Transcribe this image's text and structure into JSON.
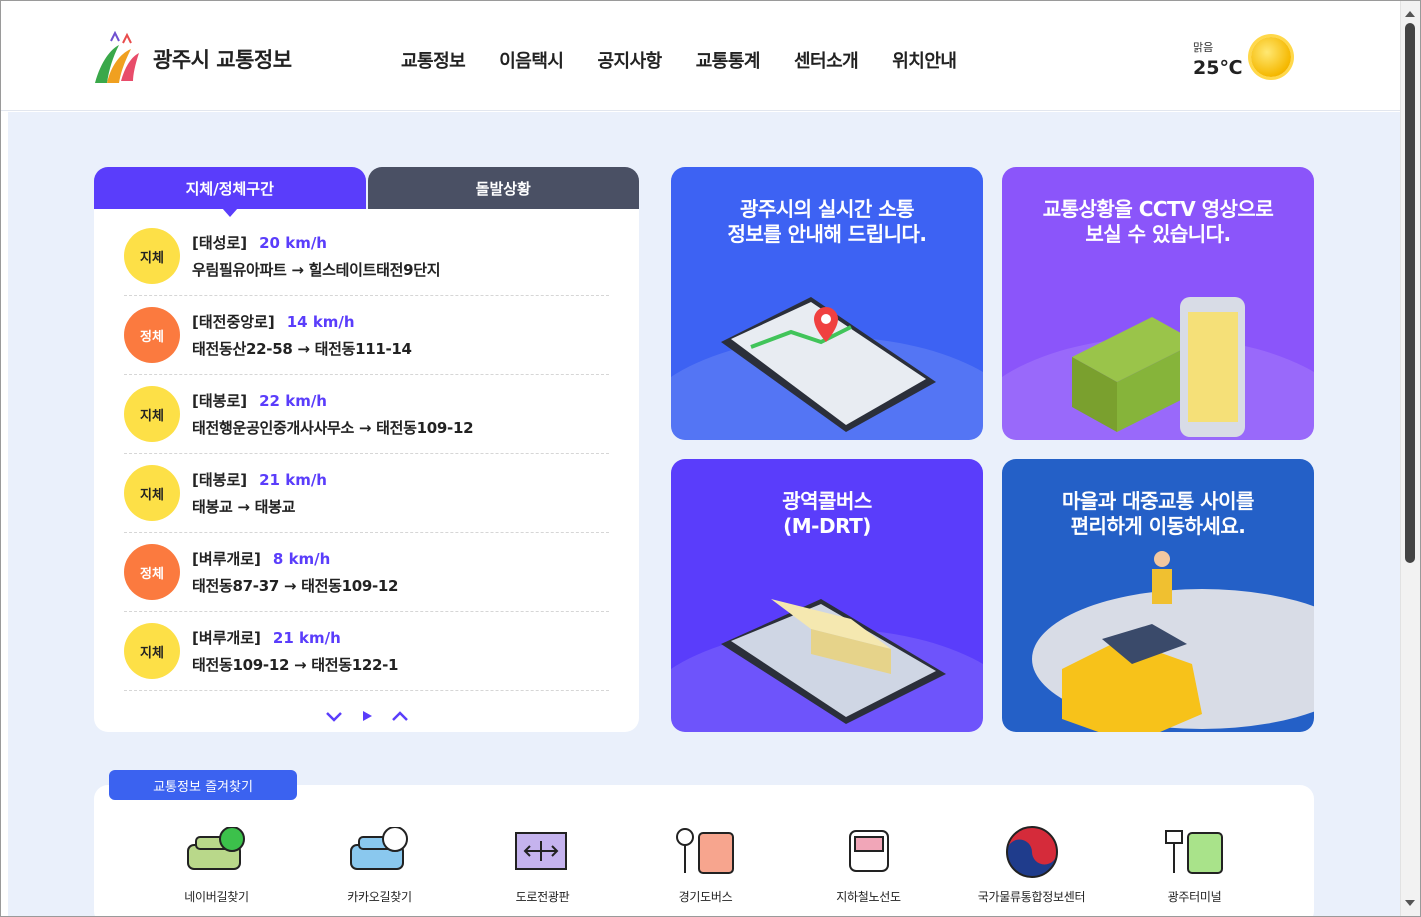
{
  "header": {
    "title": "광주시 교통정보",
    "nav": [
      "교통정보",
      "이음택시",
      "공지사항",
      "교통통계",
      "센터소개",
      "위치안내"
    ],
    "weather": {
      "condition": "맑음",
      "temperature": "25℃"
    }
  },
  "traffic_panel": {
    "tabs": [
      "지체/정체구간",
      "돌발상황"
    ],
    "items": [
      {
        "status": "지체",
        "road": "[태성로]",
        "speed": "20 km/h",
        "route": "우림필유아파트 → 힐스테이트태전9단지"
      },
      {
        "status": "정체",
        "road": "[태전중앙로]",
        "speed": "14 km/h",
        "route": "태전동산22-58 → 태전동111-14"
      },
      {
        "status": "지체",
        "road": "[태봉로]",
        "speed": "22 km/h",
        "route": "태전행운공인중개사사무소 → 태전동109-12"
      },
      {
        "status": "지체",
        "road": "[태봉로]",
        "speed": "21 km/h",
        "route": "태봉교 → 태봉교"
      },
      {
        "status": "정체",
        "road": "[벼루개로]",
        "speed": "8 km/h",
        "route": "태전동87-37 → 태전동109-12"
      },
      {
        "status": "지체",
        "road": "[벼루개로]",
        "speed": "21 km/h",
        "route": "태전동109-12 → 태전동122-1"
      }
    ],
    "pager": {
      "down": "⌄",
      "play": "▶",
      "up": "⌃"
    }
  },
  "cards": [
    {
      "title": "광주시의 실시간 소통\n정보를 안내해 드립니다."
    },
    {
      "title": "교통상황을 CCTV 영상으로\n보실 수 있습니다."
    },
    {
      "title": "광역콜버스\n(M-DRT)"
    },
    {
      "title": "마을과 대중교통 사이를\n편리하게 이동하세요."
    }
  ],
  "favorites": {
    "tag": "교통정보 즐겨찾기",
    "items": [
      "네이버길찾기",
      "카카오길찾기",
      "도로전광판",
      "경기도버스",
      "지하철노선도",
      "국가물류통합정보센터",
      "광주터미널"
    ]
  },
  "colors": {
    "accent": "#5a3dfb",
    "yellow_badge": "#fde047",
    "orange_badge": "#fb7a3f",
    "background": "#eaf0fb"
  }
}
